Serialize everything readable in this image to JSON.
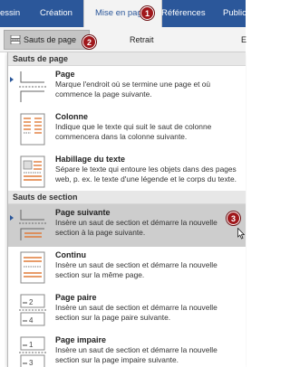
{
  "ribbon": {
    "tabs": [
      {
        "label": "essin"
      },
      {
        "label": "Création"
      },
      {
        "label": "Mise en page"
      },
      {
        "label": "Références"
      },
      {
        "label": "Public"
      }
    ],
    "commands": {
      "breaks_label": "Sauts de page",
      "indent_label": "Retrait",
      "spacing_fragment": "E"
    }
  },
  "menu": {
    "page_breaks_header": "Sauts de page",
    "section_breaks_header": "Sauts de section",
    "page_items": [
      {
        "title": "Page",
        "desc": [
          "Marque l'endroit où se termine une page et où",
          "commence la page suivante."
        ]
      },
      {
        "title": "Colonne",
        "desc": [
          "Indique que le texte qui suit le saut de colonne",
          "commencera dans la colonne suivante."
        ]
      },
      {
        "title": "Habillage du texte",
        "desc": [
          "Sépare le texte qui entoure les objets dans des pages",
          "web, p. ex. le texte d'une légende et le corps du texte."
        ]
      }
    ],
    "section_items": [
      {
        "title": "Page suivante",
        "desc": [
          "Insère un saut de section et démarre la nouvelle",
          "section à la page suivante."
        ]
      },
      {
        "title": "Continu",
        "desc": [
          "Insère un saut de section et démarre la nouvelle",
          "section sur la même page."
        ]
      },
      {
        "title": "Page paire",
        "desc": [
          "Insère un saut de section et démarre la nouvelle",
          "section sur la page paire suivante."
        ]
      },
      {
        "title": "Page impaire",
        "desc": [
          "Insère un saut de section et démarre la nouvelle",
          "section sur la page impaire suivante."
        ]
      }
    ]
  },
  "callouts": [
    "1",
    "2",
    "3"
  ],
  "thumb_numbers": {
    "even_top": "2",
    "even_bottom": "4",
    "odd_top": "1",
    "odd_bottom": "3"
  },
  "colors": {
    "ribbon_blue": "#2b579a",
    "callout_red": "#a0181c",
    "highlight_gray": "#cdcdcd"
  }
}
